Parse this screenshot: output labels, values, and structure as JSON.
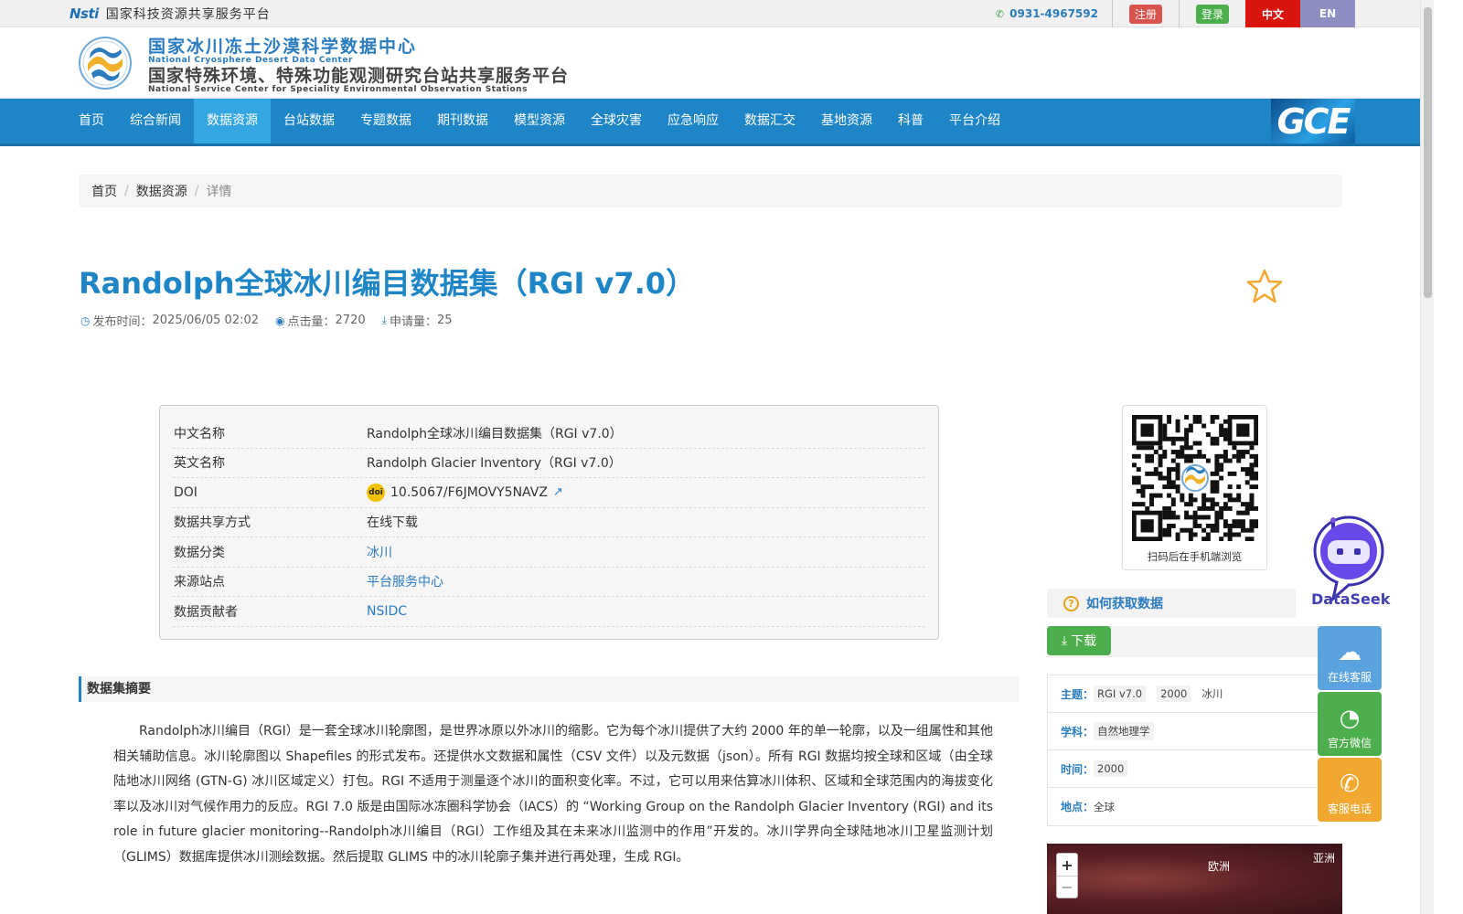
{
  "topbar": {
    "nsti_mark": "Nsti",
    "platform_name": "国家科技资源共享服务平台",
    "phone": "0931-4967592",
    "register": "注册",
    "login": "登录",
    "lang_zh": "中文",
    "lang_en": "EN"
  },
  "header": {
    "title_cn": "国家冰川冻土沙漠科学数据中心",
    "title_en": "National Cryosphere Desert Data Center",
    "subtitle_cn": "国家特殊环境、特殊功能观测研究台站共享服务平台",
    "subtitle_en": "National Service Center for Speciality Environmental Observation Stations"
  },
  "nav": {
    "items": [
      "首页",
      "综合新闻",
      "数据资源",
      "台站数据",
      "专题数据",
      "期刊数据",
      "模型资源",
      "全球灾害",
      "应急响应",
      "数据汇交",
      "基地资源",
      "科普",
      "平台介绍"
    ],
    "active": "数据资源",
    "gce": "GCE"
  },
  "breadcrumb": {
    "home": "首页",
    "section": "数据资源",
    "current": "详情",
    "separator": "/"
  },
  "dataset": {
    "title": "Randolph全球冰川编目数据集（RGI v7.0）",
    "publish_label": "发布时间：",
    "publish_time": "2025/06/05 02:02",
    "views_label": "点击量：",
    "views": "2720",
    "requests_label": "申请量：",
    "requests": "25"
  },
  "info": {
    "rows": [
      {
        "key": "中文名称",
        "value": "Randolph全球冰川编目数据集（RGI v7.0）"
      },
      {
        "key": "英文名称",
        "value": "Randolph Glacier Inventory（RGI v7.0）"
      },
      {
        "key": "DOI",
        "value": "10.5067/F6JMOVY5NAVZ"
      },
      {
        "key": "数据共享方式",
        "value": "在线下载"
      },
      {
        "key": "数据分类",
        "value": "冰川"
      },
      {
        "key": "来源站点",
        "value": "平台服务中心"
      },
      {
        "key": "数据贡献者",
        "value": "NSIDC"
      }
    ],
    "doi_badge": "doi"
  },
  "abstract": {
    "heading": "数据集摘要",
    "text": "Randolph冰川编目（RGI）是一套全球冰川轮廓图，是世界冰原以外冰川的缩影。它为每个冰川提供了大约 2000 年的单一轮廓，以及一组属性和其他相关辅助信息。冰川轮廓图以 Shapefiles 的形式发布。还提供水文数据和属性（CSV 文件）以及元数据（json）。所有 RGI 数据均按全球和区域（由全球陆地冰川网络 (GTN-G) 冰川区域定义）打包。RGI 不适用于测量逐个冰川的面积变化率。不过，它可以用来估算冰川体积、区域和全球范围内的海拔变化率以及冰川对气候作用力的反应。RGI 7.0 版是由国际冰冻圈科学协会（IACS）的 “Working Group on the Randolph Glacier Inventory (RGI) and its role in future glacier monitoring--Randolph冰川编目（RGI）工作组及其在未来冰川监测中的作用”开发的。冰川学界向全球陆地冰川卫星监测计划（GLIMS）数据库提供冰川测绘数据。然后提取 GLIMS 中的冰川轮廓子集并进行再处理，生成 RGI。"
  },
  "sidebar": {
    "qr_caption": "扫码后在手机端浏览",
    "howto": "如何获取数据",
    "download": "下载",
    "tags": {
      "theme_label": "主题：",
      "theme": [
        "RGI v7.0",
        "2000",
        "冰川"
      ],
      "subject_label": "学科：",
      "subject": "自然地理学",
      "time_label": "时间：",
      "time": "2000",
      "place_label": "地点：",
      "place": "全球"
    },
    "map": {
      "zoom_in": "+",
      "zoom_out": "−",
      "label_europe": "欧洲",
      "label_asia": "亚洲"
    }
  },
  "floating": {
    "dataseek": "DataSeek",
    "online_service": "在线客服",
    "wechat": "官方微信",
    "phone_service": "客服电话"
  },
  "colors": {
    "primary": "#1e86c6",
    "nav_active": "#34a6e2",
    "register": "#d9534f",
    "login": "#4cae4c",
    "lang_zh": "#d9160d",
    "lang_en": "#8e8fc0"
  }
}
